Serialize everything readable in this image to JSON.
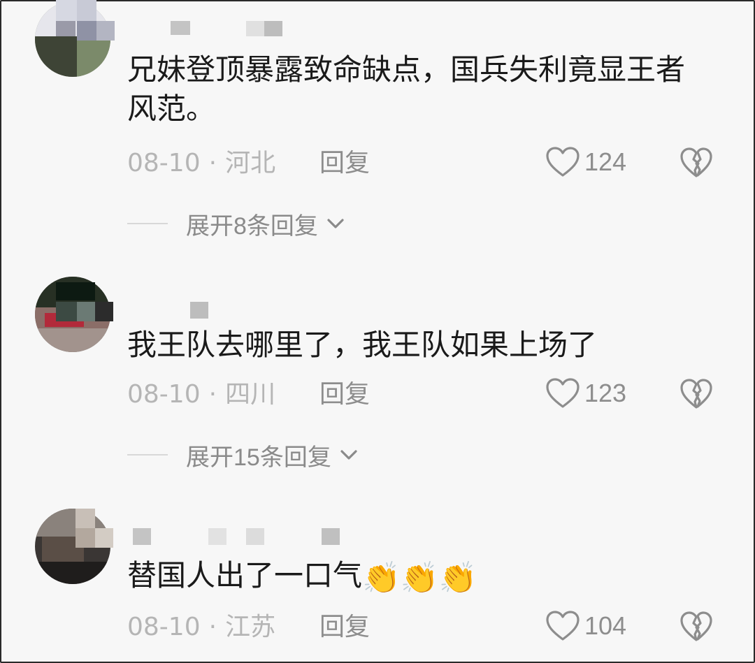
{
  "comments": [
    {
      "text": "兄妹登顶暴露致命缺点，国兵失利竟显王者风范。",
      "date": "08-10",
      "location": "河北",
      "reply_label": "回复",
      "likes": "124",
      "expand_label": "展开8条回复"
    },
    {
      "text": "我王队去哪里了，我王队如果上场了",
      "date": "08-10",
      "location": "四川",
      "reply_label": "回复",
      "likes": "123",
      "expand_label": "展开15条回复"
    },
    {
      "text": "替国人出了一口气",
      "emoji": "👏👏👏",
      "date": "08-10",
      "location": "江苏",
      "reply_label": "回复",
      "likes": "104"
    }
  ],
  "icons": {
    "like": "heart-outline-icon",
    "dislike": "broken-heart-icon",
    "expand": "chevron-down-icon"
  },
  "colors": {
    "background": "#f7f7f7",
    "text": "#1a1a1a",
    "meta": "#b5b5b5",
    "secondary": "#8d8d8d"
  }
}
